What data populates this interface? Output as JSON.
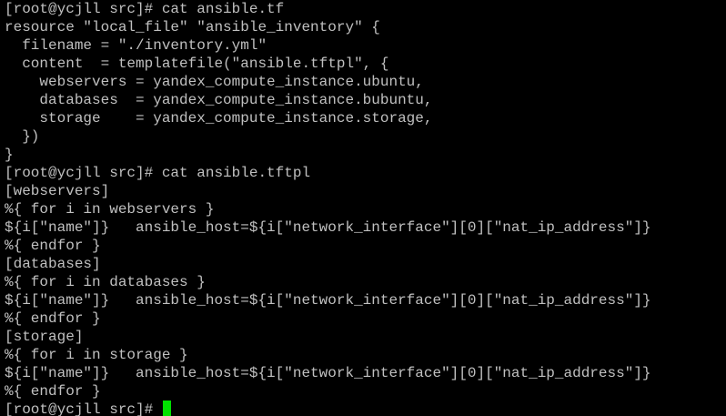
{
  "terminal": {
    "lines": [
      "[root@ycjll src]# cat ansible.tf",
      "resource \"local_file\" \"ansible_inventory\" {",
      "  filename = \"./inventory.yml\"",
      "  content  = templatefile(\"ansible.tftpl\", {",
      "    webservers = yandex_compute_instance.ubuntu,",
      "    databases  = yandex_compute_instance.bubuntu,",
      "    storage    = yandex_compute_instance.storage,",
      "  })",
      "}",
      "[root@ycjll src]# cat ansible.tftpl",
      "[webservers]",
      "%{ for i in webservers }",
      "${i[\"name\"]}   ansible_host=${i[\"network_interface\"][0][\"nat_ip_address\"]}",
      "%{ endfor }",
      "[databases]",
      "%{ for i in databases }",
      "${i[\"name\"]}   ansible_host=${i[\"network_interface\"][0][\"nat_ip_address\"]}",
      "%{ endfor }",
      "[storage]",
      "%{ for i in storage }",
      "${i[\"name\"]}   ansible_host=${i[\"network_interface\"][0][\"nat_ip_address\"]}",
      "%{ endfor }"
    ],
    "prompt": "[root@ycjll src]# ",
    "cursor_icon": "block-cursor-icon",
    "colors": {
      "background": "#000000",
      "text": "#c0c0c0",
      "cursor": "#00e000"
    }
  }
}
